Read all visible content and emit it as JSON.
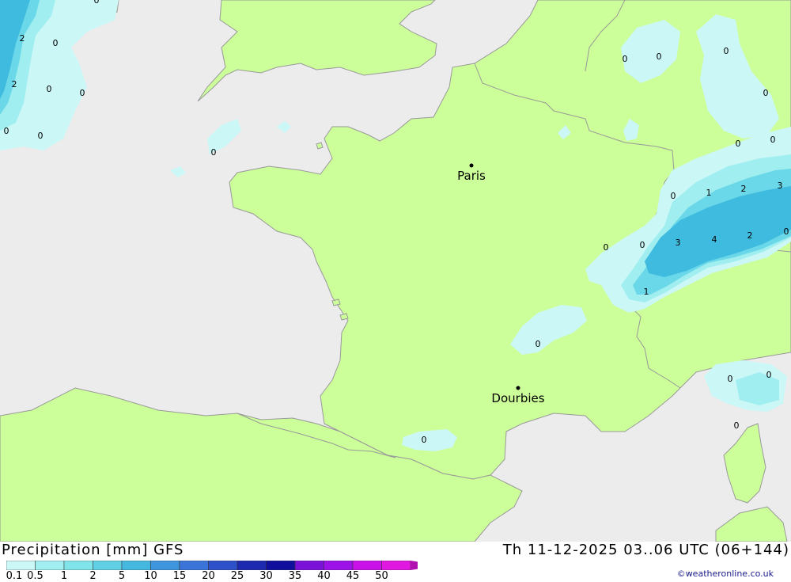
{
  "map": {
    "cities": [
      {
        "name": "Paris"
      },
      {
        "name": "Dourbies"
      }
    ],
    "contour_labels": [
      "2",
      "0",
      "0",
      "2",
      "0",
      "0",
      "0",
      "0",
      "0",
      "0",
      "0",
      "0",
      "0",
      "0",
      "0",
      "1",
      "2",
      "3",
      "0",
      "0",
      "3",
      "4",
      "2",
      "0",
      "1",
      "0",
      "0",
      "0",
      "0",
      "0",
      "0"
    ],
    "colors": {
      "sea": "#ececec",
      "land": "#ccff99",
      "coast": "#999999",
      "precip_0_1": "#ccf7f7",
      "precip_0_5": "#a0eef0",
      "precip_1": "#6ad8e8",
      "precip_2": "#3fbbe0"
    }
  },
  "footer": {
    "title": "Precipitation [mm] GFS",
    "datetime": "Th 11-12-2025 03..06 UTC (06+144)",
    "credit": "©weatheronline.co.uk",
    "scale": {
      "labels": [
        "0.1",
        "0.5",
        "1",
        "2",
        "5",
        "10",
        "15",
        "20",
        "25",
        "30",
        "35",
        "40",
        "45",
        "50"
      ],
      "colors": [
        "#ccf7f7",
        "#a0eef0",
        "#80e4ea",
        "#62d0e4",
        "#44b8de",
        "#3e95dc",
        "#3a74d8",
        "#2e50c8",
        "#1d2ab0",
        "#10109c",
        "#7a12d8",
        "#9c12e8",
        "#c812e8",
        "#e018e0",
        "#b010b0"
      ]
    }
  }
}
